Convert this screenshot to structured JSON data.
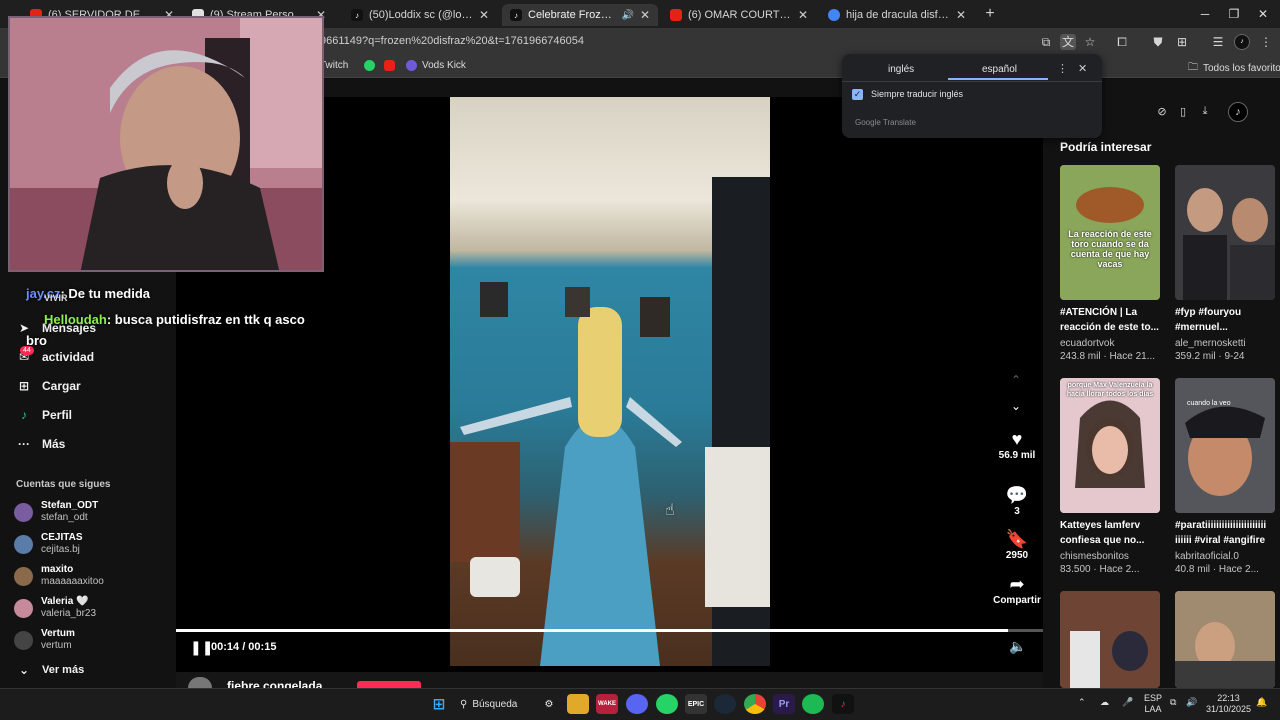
{
  "browser": {
    "tabs": [
      {
        "title": "(6) SERVIDOR DE ZHOUG",
        "favicon_color": "#e62117"
      },
      {
        "title": "(9) Stream Personal Gama",
        "favicon_color": "#e0e0e0"
      },
      {
        "title": "(50)Loddix sc (@loddixx) | TikTok",
        "favicon_color": "#111111"
      },
      {
        "title": "Celebrate Frozen Cosplay D",
        "favicon_color": "#111111",
        "active": true
      },
      {
        "title": "(6) OMAR COURTZ - LUCES DE",
        "favicon_color": "#e62117"
      },
      {
        "title": "hija de dracula disfraz - Buscar",
        "favicon_color": "#4285f4"
      }
    ],
    "new_tab": "+",
    "url": "9661149?q=frozen%20disfraz%20&t=1761966746054",
    "bookmarks": [
      "Twitch",
      "",
      "",
      "Vods Kick"
    ],
    "bookmarks_all": "Todos los favoritos"
  },
  "translate": {
    "tab1": "inglés",
    "tab2": "español",
    "always": "Siempre traducir inglés",
    "powered": "Google Translate"
  },
  "sidebar": {
    "items": [
      {
        "label": "Mensajes",
        "icon": "send-icon"
      },
      {
        "label": "actividad",
        "icon": "bell-icon",
        "badge": "44"
      },
      {
        "label": "Cargar",
        "icon": "plus-square-icon"
      },
      {
        "label": "Perfil",
        "icon": "profile-icon"
      },
      {
        "label": "Más",
        "icon": "more-icon"
      }
    ],
    "following_title": "Cuentas que sigues",
    "accounts": [
      {
        "name": "Stefan_ODT",
        "user": "stefan_odt",
        "color": "#7a5ca0"
      },
      {
        "name": "CEJITAS",
        "user": "cejitas.bj",
        "color": "#5a7ca8"
      },
      {
        "name": "maxito",
        "user": "maaaaaaxitoo",
        "color": "#8a6a4a"
      },
      {
        "name": "Valeria 🤍",
        "user": "valeria_br23",
        "color": "#c68a9a"
      },
      {
        "name": "Vertum",
        "user": "vertum",
        "color": "#444444"
      }
    ],
    "see_more": "Ver más"
  },
  "chat": {
    "messages": [
      {
        "user": "jay.cz",
        "text": ": De tu medida",
        "color": "#6c8cff"
      },
      {
        "user": "Helloudah",
        "text": ": busca putidisfraz en ttk q asco",
        "color": "#8cf04a"
      }
    ],
    "wrap": "bro",
    "partial": "VIVIR"
  },
  "player": {
    "time": "00:14 / 00:15",
    "progress": 0.96,
    "likes": "56.9 mil",
    "comments": "3",
    "saves": "2950",
    "share": "Compartir",
    "below_caption": "fiebre congelada"
  },
  "suggested": {
    "title": "Podría interesar",
    "cards": [
      {
        "caption": "#ATENCIÓN | La reacción de este to...",
        "author": "ecuadortvok",
        "stats": "243.8 mil · Hace 21...",
        "thumb_text": "La reacción de este toro cuando se da cuenta de que hay vacas",
        "colors": [
          "#6a8a3a",
          "#a05a2a"
        ]
      },
      {
        "caption": "#fyp #fouryou #mernuel...",
        "author": "ale_mernosketti",
        "stats": "359.2 mil · 9-24",
        "thumb_text": "",
        "colors": [
          "#2a2a30",
          "#7a5a4a"
        ]
      },
      {
        "caption": "Katteyes lamferv confiesa que no...",
        "author": "chismesbonitos",
        "stats": "83.500 · Hace 2...",
        "thumb_text": "porque Max Valenzuela la hacía llorar todos los días",
        "colors": [
          "#d8b0b8",
          "#6a4a5a"
        ]
      },
      {
        "caption": "#paratiiiiiiiiiiiiiiiiiiiiii iiiiii #viral #angifire",
        "author": "kabritaoficial.0",
        "stats": "40.8 mil · Hace 2...",
        "thumb_text": "cuando la veo",
        "colors": [
          "#4a4a50",
          "#c08a6a"
        ]
      },
      {
        "caption": "",
        "author": "",
        "stats": "",
        "thumb_text": "",
        "colors": [
          "#6a4a3a",
          "#3a3a2a"
        ]
      },
      {
        "caption": "",
        "author": "",
        "stats": "",
        "thumb_text": "",
        "colors": [
          "#8a7a6a",
          "#3a3a3a"
        ]
      }
    ]
  },
  "taskbar": {
    "search": "Búsqueda",
    "lang": "ESP",
    "lang2": "LAA",
    "time": "22:13",
    "date": "31/10/2025"
  }
}
